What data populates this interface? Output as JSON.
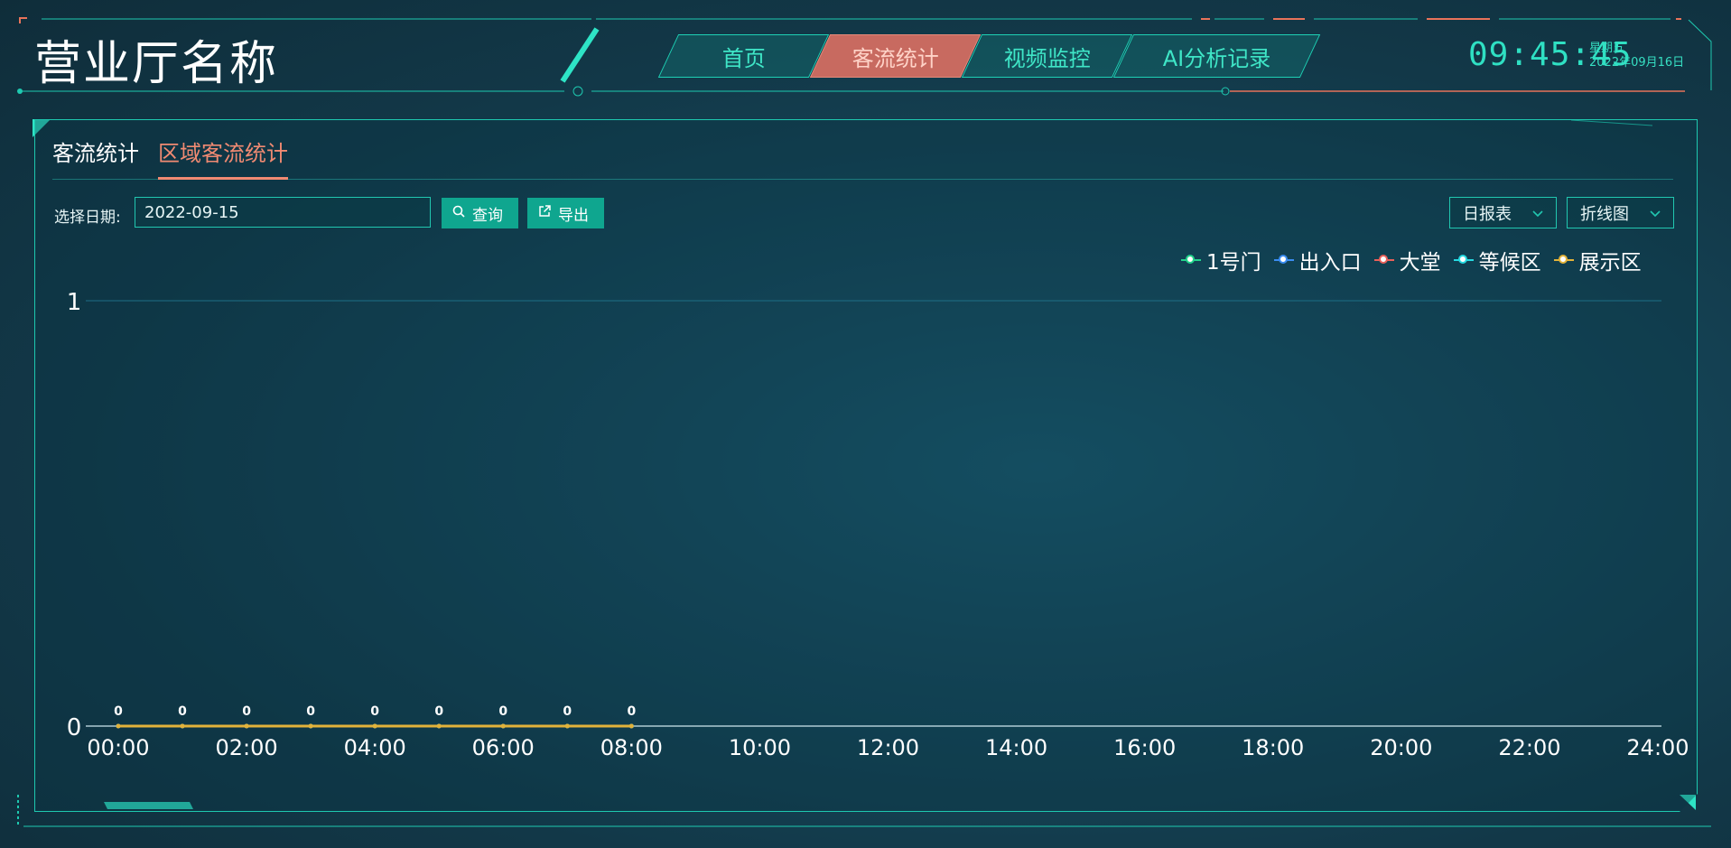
{
  "header": {
    "title": "营业厅名称",
    "nav": [
      {
        "label": "首页",
        "active": false
      },
      {
        "label": "客流统计",
        "active": true
      },
      {
        "label": "视频监控",
        "active": false
      },
      {
        "label": "AI分析记录",
        "active": false
      }
    ],
    "time": "09:45:45",
    "weekday": "星期五",
    "date": "2022年09月16日"
  },
  "tabs": [
    {
      "label": "客流统计",
      "active": false
    },
    {
      "label": "区域客流统计",
      "active": true
    }
  ],
  "filters": {
    "date_label": "选择日期:",
    "date_value": "2022-09-15",
    "query_label": "查询",
    "export_label": "导出",
    "report_select": "日报表",
    "chart_select": "折线图"
  },
  "colors": {
    "accent": "#1ed1b5",
    "active_nav": "#c86a60",
    "active_tab": "#f08a72"
  },
  "chart_data": {
    "type": "line",
    "x_ticks": [
      "00:00",
      "02:00",
      "04:00",
      "06:00",
      "08:00",
      "10:00",
      "12:00",
      "14:00",
      "16:00",
      "18:00",
      "20:00",
      "22:00",
      "24:00"
    ],
    "x": [
      "00:00",
      "01:00",
      "02:00",
      "03:00",
      "04:00",
      "05:00",
      "06:00",
      "07:00",
      "08:00"
    ],
    "ylim": [
      0,
      1
    ],
    "y_ticks": [
      "0",
      "1"
    ],
    "series": [
      {
        "name": "1号门",
        "color": "#21d28a",
        "values": [
          0,
          0,
          0,
          0,
          0,
          0,
          0,
          0,
          0
        ]
      },
      {
        "name": "出入口",
        "color": "#3a8cf0",
        "values": [
          0,
          0,
          0,
          0,
          0,
          0,
          0,
          0,
          0
        ]
      },
      {
        "name": "大堂",
        "color": "#e8605a",
        "values": [
          0,
          0,
          0,
          0,
          0,
          0,
          0,
          0,
          0
        ]
      },
      {
        "name": "等候区",
        "color": "#25d8e0",
        "values": [
          0,
          0,
          0,
          0,
          0,
          0,
          0,
          0,
          0
        ]
      },
      {
        "name": "展示区",
        "color": "#e2b23a",
        "values": [
          0,
          0,
          0,
          0,
          0,
          0,
          0,
          0,
          0
        ]
      }
    ],
    "data_labels": [
      "0",
      "0",
      "0",
      "0",
      "0",
      "0",
      "0",
      "0",
      "0"
    ],
    "legend_position": "top-right",
    "grid": true
  }
}
